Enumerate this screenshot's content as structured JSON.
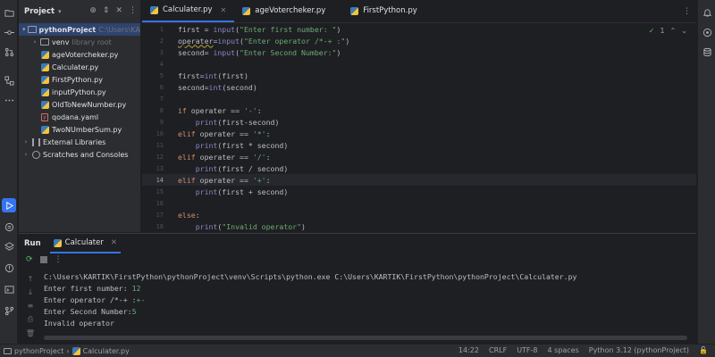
{
  "project_panel": {
    "title": "Project",
    "root": {
      "name": "pythonProject",
      "path": "C:\\Users\\KARTIK"
    },
    "items": [
      {
        "name": "venv",
        "note": "library root",
        "kind": "folder"
      },
      {
        "name": "ageVotercheker.py",
        "kind": "py"
      },
      {
        "name": "Calculater.py",
        "kind": "py"
      },
      {
        "name": "FirstPython.py",
        "kind": "py"
      },
      {
        "name": "inputPython.py",
        "kind": "py"
      },
      {
        "name": "OldToNewNumber.py",
        "kind": "py"
      },
      {
        "name": "qodana.yaml",
        "kind": "yaml"
      },
      {
        "name": "TwoNUmberSum.py",
        "kind": "py"
      }
    ],
    "external_libraries": "External Libraries",
    "scratches": "Scratches and Consoles"
  },
  "tabs": [
    {
      "label": "Calculater.py",
      "active": true
    },
    {
      "label": "ageVotercheker.py",
      "active": false
    },
    {
      "label": "FirstPython.py",
      "active": false
    }
  ],
  "inspection": {
    "count": "1"
  },
  "editor": {
    "line_numbers": [
      "1",
      "2",
      "3",
      "4",
      "5",
      "6",
      "7",
      "8",
      "9",
      "10",
      "11",
      "12",
      "13",
      "14",
      "15",
      "16",
      "17",
      "18"
    ],
    "current_line": "14",
    "code": {
      "l1_a": "first = ",
      "l1_fn": "input",
      "l1_str": "\"Enter first number: \"",
      "l1_b": "(",
      "l1_c": ")",
      "l2_var": "operater",
      "l2_a": "=",
      "l2_fn": "input",
      "l2_str": "\"Enter operator /*-+ :\"",
      "l3_a": "second= ",
      "l3_fn": "input",
      "l3_str": "\"Enter Second Number:\"",
      "l5_a": "first=",
      "l5_fn": "int",
      "l5_b": "(first)",
      "l6_a": "second=",
      "l6_fn": "int",
      "l6_b": "(second)",
      "l8_kw": "if",
      "l8_a": " operater == ",
      "l8_str": "'-'",
      "l8_b": ":",
      "l9_fn": "print",
      "l9_a": "(first-second)",
      "l10_kw": "elif",
      "l10_a": " operater == ",
      "l10_str": "'*'",
      "l10_b": ":",
      "l11_fn": "print",
      "l11_a": "(first * second)",
      "l12_kw": "elif",
      "l12_a": " operater == ",
      "l12_str": "'/'",
      "l12_b": ":",
      "l13_fn": "print",
      "l13_a": "(first / second)",
      "l14_kw": "elif",
      "l14_a": " operater == ",
      "l14_str": "'+'",
      "l14_b": ":",
      "l15_fn": "print",
      "l15_a": "(first + second)",
      "l17_kw": "else",
      "l17_a": ":",
      "l18_fn": "print",
      "l18_str": "\"Invalid operator\"",
      "l18_b": "(",
      "l18_c": ")"
    }
  },
  "run_panel": {
    "title": "Run",
    "tab_label": "Calculater",
    "console": {
      "command": "C:\\Users\\KARTIK\\FirstPython\\pythonProject\\venv\\Scripts\\python.exe C:\\Users\\KARTIK\\FirstPython\\pythonProject\\Calculater.py",
      "prompt1": "Enter first number: ",
      "input1": "12",
      "prompt2": "Enter operator /*-+ :",
      "input2": "+-",
      "prompt3": "Enter Second Number:",
      "input3": "5",
      "output": "Invalid operator"
    }
  },
  "statusbar": {
    "project": "pythonProject",
    "file": "Calculater.py",
    "position": "14:22",
    "line_sep": "CRLF",
    "encoding": "UTF-8",
    "indent": "4 spaces",
    "interpreter": "Python 3.12 (pythonProject)"
  }
}
